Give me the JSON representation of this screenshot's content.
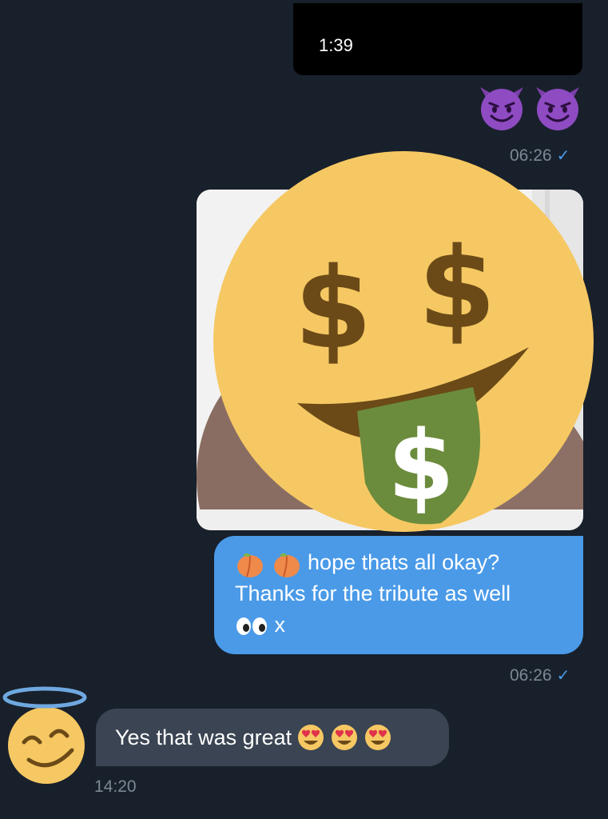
{
  "video_message": {
    "duration": "1:39"
  },
  "reactions_out": [
    "smiling-devil",
    "smiling-devil"
  ],
  "timestamps": {
    "first_out": "06:26",
    "second_out": "06:26",
    "incoming": "14:20"
  },
  "check_mark": "✓",
  "outgoing_message": {
    "line1": "hope thats all okay?",
    "line2": "Thanks for the tribute as well",
    "line3_suffix": "x"
  },
  "incoming_message": {
    "text": "Yes that was great"
  },
  "colors": {
    "background": "#18202b",
    "bubble_out": "#4a9ae8",
    "bubble_in": "#3a4452",
    "timestamp": "#7d8894",
    "check": "#4a9ae6"
  }
}
